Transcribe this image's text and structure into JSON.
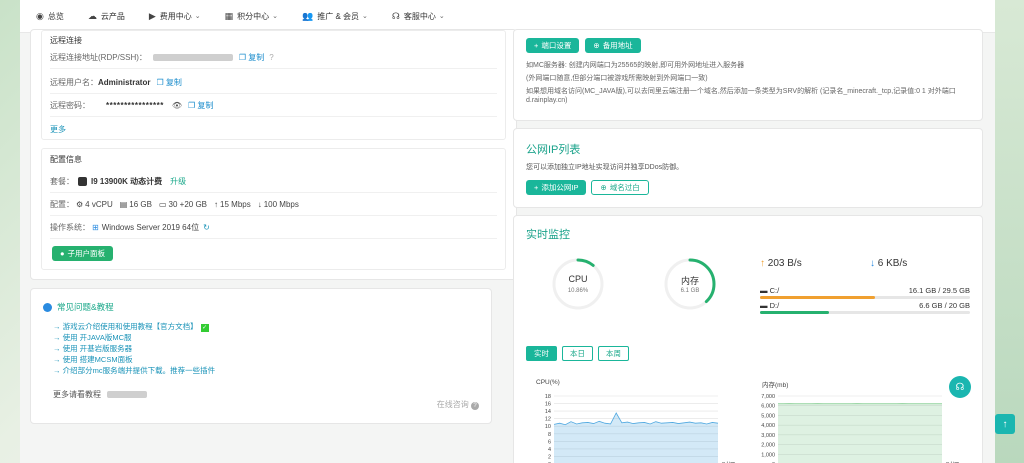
{
  "nav": [
    {
      "icon": "dashboard-icon",
      "glyph": "◉",
      "label": "总览",
      "chevron": false
    },
    {
      "icon": "cloud-icon",
      "glyph": "☁",
      "label": "云产品",
      "chevron": false
    },
    {
      "icon": "video-icon",
      "glyph": "▶",
      "label": "费用中心",
      "chevron": true
    },
    {
      "icon": "points-icon",
      "glyph": "▦",
      "label": "积分中心",
      "chevron": true
    },
    {
      "icon": "users-icon",
      "glyph": "👥",
      "label": "推广 & 会员",
      "chevron": true
    },
    {
      "icon": "headset-icon",
      "glyph": "☊",
      "label": "客服中心",
      "chevron": true
    }
  ],
  "remote": {
    "title": "远程连接",
    "addr_label": "远程连接地址(RDP/SSH)：",
    "copy": "复制",
    "user_label": "远程用户名：",
    "user_value": "Administrator",
    "pwd_label": "远程密码：",
    "pwd_value": "****************",
    "more": "更多"
  },
  "config": {
    "title": "配置信息",
    "plan_label": "套餐：",
    "plan_value": "I9 13900K 动态计费",
    "upgrade": "升级",
    "spec_label": "配置：",
    "cpu": "4 vCPU",
    "mem": "16 GB",
    "disk": "30 +20 GB",
    "up": "15 Mbps",
    "down": "100 Mbps",
    "os_label": "操作系统：",
    "os_value": "Windows Server 2019 64位",
    "sub_panel_btn": "子用户面板"
  },
  "faq": {
    "title": "常见问题&教程",
    "items": [
      "游戏云介绍使用和使用教程【官方文档】",
      "使用             开JAVA版MC服",
      "使用             开基岩版服务器",
      "使用             搭建MCSM面板",
      "介绍部分mc服务端并提供下载。推荐一些插件"
    ],
    "more": "更多请看教程",
    "online": "在线咨询"
  },
  "port": {
    "btn_port": "端口设置",
    "btn_backup": "备用地址",
    "line1": "如MC服务器: 创建内网端口为25565的映射,即可用外网地址进入服务器",
    "line2": "(外网端口随意,但部分端口被游戏所需映射到外网端口一致)",
    "line3": "如果想用域名访问(MC_JAVA版),可以去同里云端注册一个域名,然后添加一条类型为SRV的解析 (记录名_minecraft._tcp,记录值:0 1 对外端口",
    "line4": "d.rainplay.cn)"
  },
  "public_ip": {
    "title": "公网IP列表",
    "desc": "您可以添加独立IP地址实现访问并独享DDos防御。",
    "btn_add": "添加公网IP",
    "btn_whitelist": "域名过白"
  },
  "monitor": {
    "title": "实时监控",
    "cpu_label": "CPU",
    "cpu_value": "10.86%",
    "cpu_percent": 10.86,
    "mem_label": "内存",
    "mem_value": "6.1 GB",
    "mem_percent": 38,
    "net_up": "203 B/s",
    "net_down": "6 KB/s",
    "disks": [
      {
        "name": "C:/",
        "usage": "16.1 GB / 29.5 GB",
        "fraction": 0.546,
        "color": "#f0a030"
      },
      {
        "name": "D:/",
        "usage": "6.6 GB / 20 GB",
        "fraction": 0.33,
        "color": "#26b16f"
      }
    ],
    "tabs": [
      "实时",
      "本日",
      "本周"
    ],
    "cpu_chart_title": "CPU(%)",
    "mem_chart_title": "内存(mb)",
    "x_label": "时间"
  },
  "chart_data": [
    {
      "type": "area",
      "title": "CPU(%)",
      "xlabel": "时间",
      "ylabel": "CPU(%)",
      "ylim": [
        0,
        18
      ],
      "yticks": [
        0,
        2,
        4,
        6,
        8,
        10,
        12,
        14,
        16,
        18
      ],
      "series": [
        {
          "values": [
            10.5,
            10.8,
            10.4,
            11.2,
            10.6,
            10.9,
            11.0,
            10.7,
            11.3,
            10.8,
            10.6,
            13.5,
            10.9,
            11.1,
            10.7,
            10.9,
            11.0,
            10.6,
            11.2,
            10.8,
            10.9,
            11.0,
            10.7,
            10.9,
            11.1,
            10.8,
            10.9,
            10.6,
            11.0,
            10.8
          ]
        }
      ],
      "color": "#4fa8e0"
    },
    {
      "type": "area",
      "title": "内存(mb)",
      "xlabel": "时间",
      "ylabel": "内存(mb)",
      "ylim": [
        0,
        7000
      ],
      "yticks": [
        0,
        1000,
        2000,
        3000,
        4000,
        5000,
        6000,
        7000
      ],
      "series": [
        {
          "values": [
            6200,
            6200,
            6210,
            6200,
            6205,
            6200,
            6200,
            6210,
            6200,
            6200,
            6205,
            6200,
            6200,
            6200,
            6210,
            6200,
            6200,
            6205,
            6200,
            6200,
            6200,
            6200,
            6210,
            6200,
            6200,
            6200,
            6205,
            6200,
            6200,
            6200
          ]
        }
      ],
      "color": "#7cc98a"
    }
  ]
}
